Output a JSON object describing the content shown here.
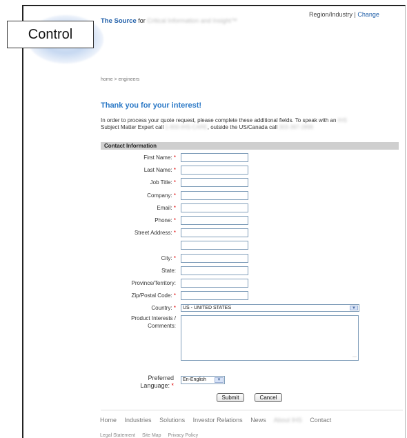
{
  "header": {
    "tagline_brand": "The Source",
    "tagline_for": "for",
    "tagline_rest": "Critical Information and Insight™",
    "region_label": "Region/Industry |",
    "region_change": "Change"
  },
  "overlay_label": "Control",
  "breadcrumb": "home > engineers",
  "heading": "Thank you for your interest!",
  "intro": {
    "part1": "In order to process your quote request, please complete these additional fields. To speak with an",
    "blur1": "IHS",
    "part2": "Subject Matter Expert call",
    "blur2": "1-800-IHS-CARE",
    "part3": ", outside the US/Canada call",
    "blur3": "303-397-2896"
  },
  "section_title": "Contact Information",
  "fields": {
    "first_name": "First Name:",
    "last_name": "Last Name:",
    "job_title": "Job Title:",
    "company": "Company:",
    "email": "Email:",
    "phone": "Phone:",
    "street": "Street Address:",
    "city": "City:",
    "state": "State:",
    "province": "Province/Territory:",
    "zip": "Zip/Postal Code:",
    "country": "Country:",
    "comments_line1": "Product Interests /",
    "comments_line2": "Comments:",
    "language_line1": "Preferred",
    "language_line2": "Language:",
    "required_mark": "*"
  },
  "country_value": "US - UNITED STATES",
  "language_value": "En-English",
  "buttons": {
    "submit": "Submit",
    "cancel": "Cancel"
  },
  "footer_nav": [
    "Home",
    "Industries",
    "Solutions",
    "Investor Relations",
    "News",
    "About IHS",
    "Contact"
  ],
  "footer_legal": [
    "Legal Statement",
    "Site Map",
    "Privacy Policy"
  ]
}
